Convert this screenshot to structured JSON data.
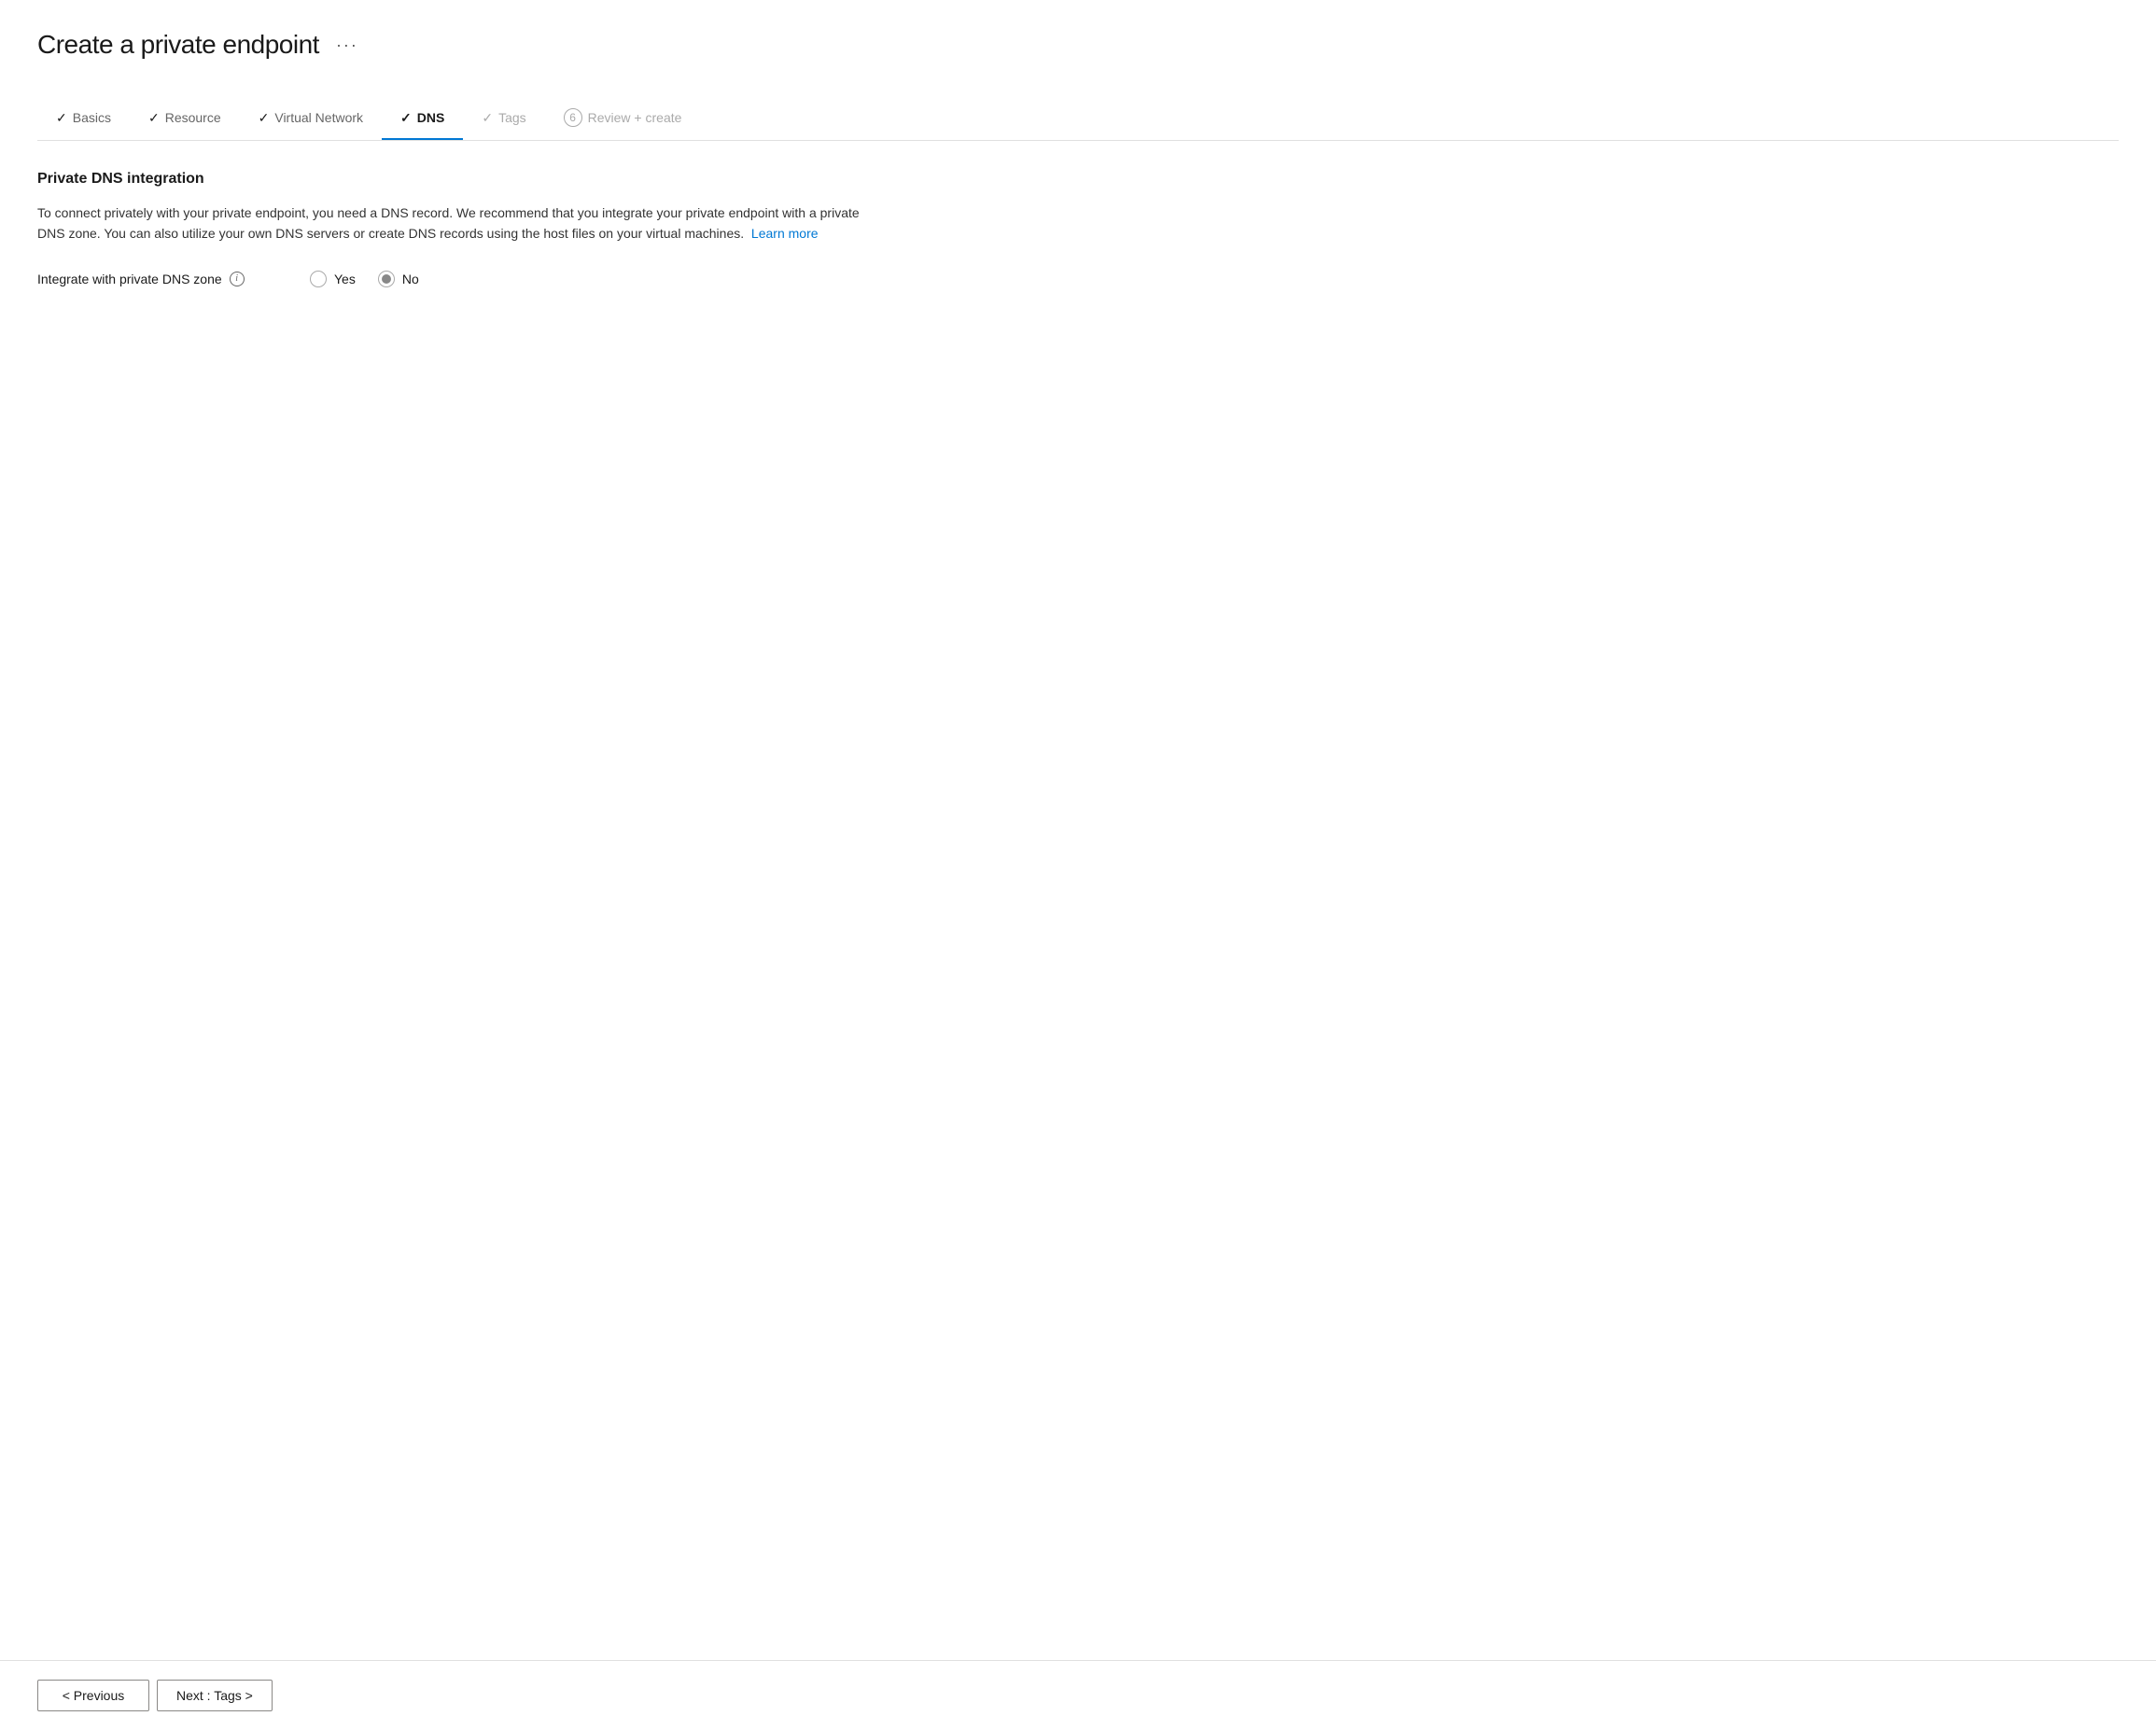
{
  "page": {
    "title": "Create a private endpoint",
    "ellipsis": "···"
  },
  "tabs": [
    {
      "id": "basics",
      "label": "Basics",
      "state": "completed",
      "check": "✓"
    },
    {
      "id": "resource",
      "label": "Resource",
      "state": "completed",
      "check": "✓"
    },
    {
      "id": "virtual-network",
      "label": "Virtual Network",
      "state": "completed",
      "check": "✓"
    },
    {
      "id": "dns",
      "label": "DNS",
      "state": "active",
      "check": "✓"
    },
    {
      "id": "tags",
      "label": "Tags",
      "state": "disabled",
      "check": "✓"
    },
    {
      "id": "review-create",
      "label": "Review + create",
      "state": "numbered",
      "number": "6"
    }
  ],
  "section": {
    "title": "Private DNS integration",
    "description": "To connect privately with your private endpoint, you need a DNS record. We recommend that you integrate your private endpoint with a private DNS zone. You can also utilize your own DNS servers or create DNS records using the host files on your virtual machines.",
    "learn_more_label": "Learn more",
    "field_label": "Integrate with private DNS zone",
    "info_icon": "i",
    "radio_options": [
      {
        "id": "yes",
        "label": "Yes",
        "selected": false
      },
      {
        "id": "no",
        "label": "No",
        "selected": true
      }
    ]
  },
  "footer": {
    "previous_label": "< Previous",
    "next_label": "Next : Tags >"
  }
}
